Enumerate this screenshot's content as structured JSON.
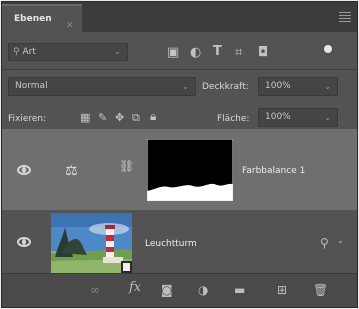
{
  "tab": {
    "label": "Ebenen"
  },
  "filter": {
    "kind": "Art"
  },
  "blend": {
    "mode": "Normal",
    "opacity_label": "Deckkraft:",
    "opacity_value": "100%"
  },
  "lock": {
    "label": "Fixieren:",
    "fill_label": "Fläche:",
    "fill_value": "100%"
  },
  "layers": [
    {
      "name": "Farbbalance 1",
      "type": "adjustment",
      "selected": true
    },
    {
      "name": "Leuchtturm",
      "type": "smart-object",
      "selected": false
    }
  ],
  "footer": {
    "fx_label": "fx"
  },
  "colors": {
    "panel": "#535353",
    "selected_row": "#6f6f6f",
    "tab_bar": "#3c3c3c"
  }
}
